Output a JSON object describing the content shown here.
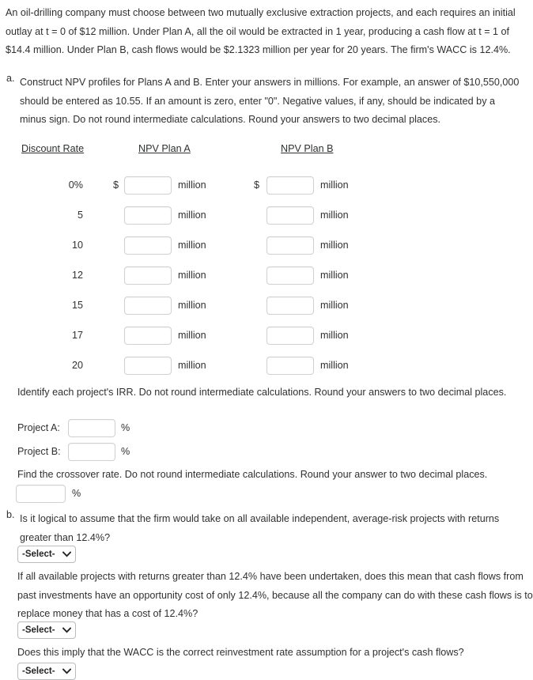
{
  "problem": {
    "intro": "An oil-drilling company must choose between two mutually exclusive extraction projects, and each requires an initial outlay at t = 0 of $12 million. Under Plan A, all the oil would be extracted in 1 year, producing a cash flow at t = 1 of $14.4 million. Under Plan B, cash flows would be $2.1323 million per year for 20 years. The firm's WACC is 12.4%."
  },
  "part_a": {
    "marker": "a.",
    "text": "Construct NPV profiles for Plans A and B. Enter your answers in millions. For example, an answer of $10,550,000 should be entered as 10.55. If an amount is zero, enter \"0\". Negative values, if any, should be indicated by a minus sign. Do not round intermediate calculations. Round your answers to two decimal places.",
    "table": {
      "headers": {
        "rate": "Discount Rate",
        "plan_a": "NPV Plan A",
        "plan_b": "NPV Plan B"
      },
      "currency_symbol": "$",
      "unit_label": "million",
      "rows": [
        {
          "rate": "0%",
          "show_currency": true,
          "npv_a": "",
          "npv_b": ""
        },
        {
          "rate": "5",
          "show_currency": false,
          "npv_a": "",
          "npv_b": ""
        },
        {
          "rate": "10",
          "show_currency": false,
          "npv_a": "",
          "npv_b": ""
        },
        {
          "rate": "12",
          "show_currency": false,
          "npv_a": "",
          "npv_b": ""
        },
        {
          "rate": "15",
          "show_currency": false,
          "npv_a": "",
          "npv_b": ""
        },
        {
          "rate": "17",
          "show_currency": false,
          "npv_a": "",
          "npv_b": ""
        },
        {
          "rate": "20",
          "show_currency": false,
          "npv_a": "",
          "npv_b": ""
        }
      ]
    },
    "irr": {
      "intro": "Identify each project's IRR. Do not round intermediate calculations. Round your answers to two decimal places.",
      "project_a_label": "Project A:",
      "project_a_value": "",
      "project_b_label": "Project B:",
      "project_b_value": "",
      "percent_symbol": "%"
    },
    "crossover": {
      "intro": "Find the crossover rate. Do not round intermediate calculations. Round your answer to two decimal places.",
      "value": "",
      "percent_symbol": "%"
    }
  },
  "part_b": {
    "marker": "b.",
    "question_1": "Is it logical to assume that the firm would take on all available independent, average-risk projects with returns greater than 12.4%?",
    "select_1": "-Select-",
    "question_2": "If all available projects with returns greater than 12.4% have been undertaken, does this mean that cash flows from past investments have an opportunity cost of only 12.4%, because all the company can do with these cash flows is to replace money that has a cost of 12.4%?",
    "select_2": "-Select-",
    "question_3": "Does this imply that the WACC is the correct reinvestment rate assumption for a project's cash flows?",
    "select_3": "-Select-"
  },
  "theme": {
    "text_color": "#2f3031",
    "input_border": "#cfd0d2",
    "select_border": "#b9bbbd",
    "background": "#ffffff"
  }
}
